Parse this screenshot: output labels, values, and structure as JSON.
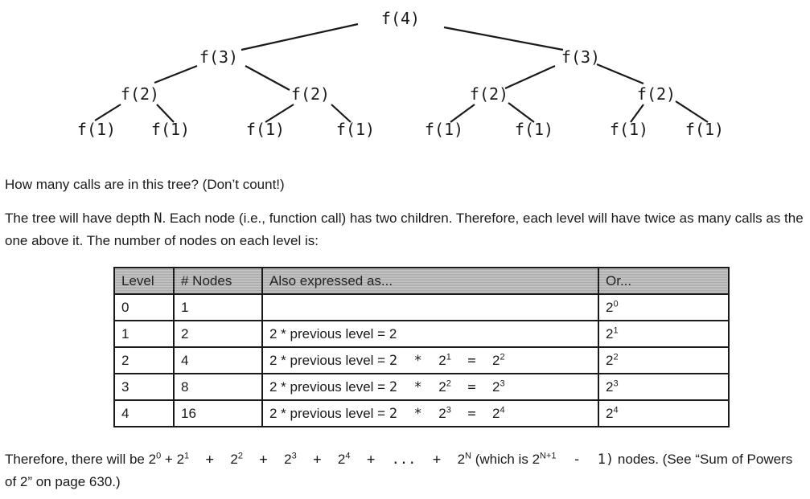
{
  "tree": {
    "root": "f(4)",
    "level1": [
      "f(3)",
      "f(3)"
    ],
    "level2": [
      "f(2)",
      "f(2)",
      "f(2)",
      "f(2)"
    ],
    "level3": [
      "f(1)",
      "f(1)",
      "f(1)",
      "f(1)",
      "f(1)",
      "f(1)",
      "f(1)",
      "f(1)"
    ]
  },
  "question": "How many calls are in this tree? (Don’t count!)",
  "explanation": {
    "before_n": "The tree will have depth ",
    "n": "N",
    "after_n": ". Each node (i.e., function call) has two children. Therefore, each level will have twice as many calls as the one above it. The number of nodes on each level is:"
  },
  "table": {
    "headers": [
      "Level",
      "# Nodes",
      "Also expressed as...",
      "Or..."
    ],
    "rows": [
      {
        "level": "0",
        "nodes": "1",
        "expr": "",
        "or_base": "2",
        "or_exp": "0"
      },
      {
        "level": "1",
        "nodes": "2",
        "expr": "2 * previous level = 2",
        "or_base": "2",
        "or_exp": "1"
      },
      {
        "level": "2",
        "nodes": "4",
        "expr_prefix": "2 * previous level = ",
        "expr_mul": "2  *  ",
        "b1": "2",
        "e1": "1",
        "eq": "  =  ",
        "b2": "2",
        "e2": "2",
        "or_base": "2",
        "or_exp": "2"
      },
      {
        "level": "3",
        "nodes": "8",
        "expr_prefix": "2 * previous level = ",
        "expr_mul": "2  *  ",
        "b1": "2",
        "e1": "2",
        "eq": "  =  ",
        "b2": "2",
        "e2": "3",
        "or_base": "2",
        "or_exp": "3"
      },
      {
        "level": "4",
        "nodes": "16",
        "expr_prefix": "2 * previous level = ",
        "expr_mul": "2  *  ",
        "b1": "2",
        "e1": "3",
        "eq": "  =  ",
        "b2": "2",
        "e2": "4",
        "or_base": "2",
        "or_exp": "4"
      }
    ]
  },
  "conclusion": {
    "prefix": "Therefore, there will be ",
    "terms": [
      {
        "base": "2",
        "exp": "0",
        "sep": " + "
      },
      {
        "base": "2",
        "exp": "1",
        "sep": "  +  "
      },
      {
        "base": "2",
        "exp": "2",
        "sep": "  +  "
      },
      {
        "base": "2",
        "exp": "3",
        "sep": "  +  "
      },
      {
        "base": "2",
        "exp": "4",
        "sep": "  +  ...  +  "
      },
      {
        "base": "2",
        "exp": "N",
        "sep": ""
      }
    ],
    "which_is": " (which is ",
    "which_base": "2",
    "which_exp": "N+1",
    "minus": "  -  1)",
    "suffix": " nodes. (See “Sum of Powers of 2” on page 630.)"
  }
}
